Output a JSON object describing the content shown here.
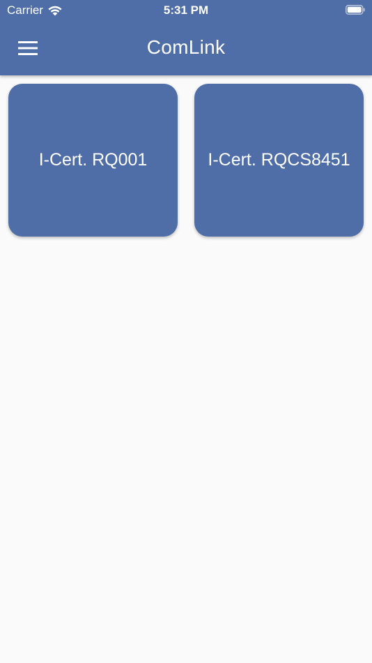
{
  "status_bar": {
    "carrier": "Carrier",
    "time": "5:31 PM",
    "wifi_icon": "wifi-icon",
    "battery_icon": "battery-icon"
  },
  "app_bar": {
    "title": "ComLink",
    "menu_icon": "menu-icon",
    "color": "#4f6ea8"
  },
  "cards": [
    {
      "label": "I-Cert. RQ001"
    },
    {
      "label": "I-Cert. RQCS8451"
    }
  ],
  "colors": {
    "primary": "#4f6ea8",
    "background": "#fafafa",
    "on_primary": "#ffffff"
  }
}
